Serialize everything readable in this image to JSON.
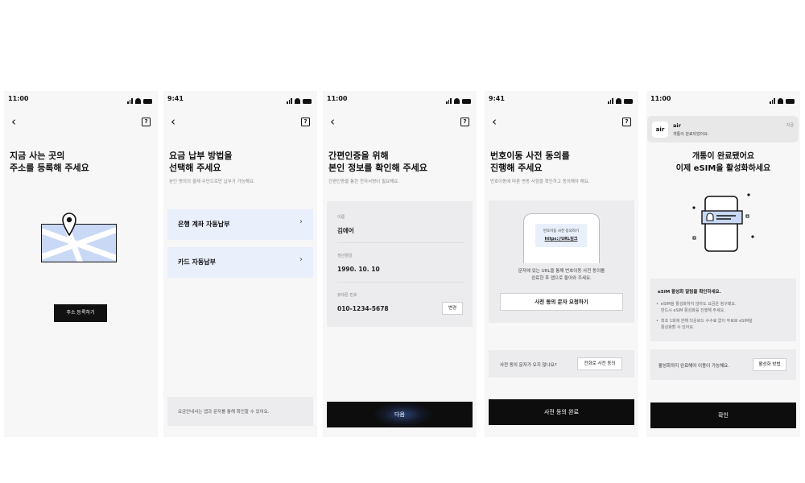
{
  "colors": {
    "accent_card": "#e9f0fc",
    "map_fill": "#c9d8f5",
    "primary_button": "#0d0d0d",
    "background": "#f7f7f8"
  },
  "icons": {
    "back": "chevron-left-icon",
    "help": "help-question-icon"
  },
  "screens": [
    {
      "status_time": "11:00",
      "title": "지금 사는 곳의\n주소를 등록해 주세요",
      "register_button": "주소 등록하기"
    },
    {
      "status_time": "9:41",
      "title": "요금 납부 방법을\n선택해 주세요",
      "subtitle": "본인 명의의 결제 수단으로만 납부가 가능해요.",
      "options": [
        "은행 계좌 자동납부",
        "카드 자동납부"
      ],
      "notice": "요금안내서는 앱과 문자를 통해 확인할 수 있어요."
    },
    {
      "status_time": "11:00",
      "title": "간편인증을 위해\n본인 정보를 확인해 주세요",
      "subtitle": "간편인증을 통한 전자서명이 필요해요.",
      "fields": [
        {
          "label": "이름",
          "value": "김에어"
        },
        {
          "label": "생년월일",
          "value": "1990. 10. 10"
        },
        {
          "label": "휴대폰 번호",
          "value": "010-1234-5678"
        }
      ],
      "change_button": "변경",
      "next_button": "다음"
    },
    {
      "status_time": "9:41",
      "title": "번호이동 사전 동의를\n진행해 주세요",
      "subtitle": "번호이동에 따른 변동 사항을 확인하고 동의해야 해요.",
      "sms_preview_title": "번호이동 사전 동의하기",
      "sms_preview_link": "https://URL링크",
      "description": "문자에 있는 URL을 통해 번호이동 사전 동의를\n완료한 후 앱으로 돌아와 주세요.",
      "request_button": "사전 동의 문자 요청하기",
      "no_sms_question": "사전 동의 문자가 오지 않나요?",
      "phone_consent_button": "전화로 사전 동의",
      "complete_button": "사전 동의 완료"
    },
    {
      "status_time": "11:00",
      "notification": {
        "app_icon_text": "air",
        "title": "air",
        "body": "개통이 완료되었어요.",
        "time": "지금"
      },
      "title": "개통이 완료됐어요\n이제 eSIM을 활성화하세요",
      "info_heading": "eSIM 활성화 알림을 확인하세요.",
      "info_items": [
        "eSIM을 활성화하지 않아도 요금은 청구돼요.\n반드시 eSIM 활성화를 진행해 주세요.",
        "최초 1회에 한해 다운로드 수수료 없이 무료로 eSIM을\n활성화할 수 있어요."
      ],
      "activation_question": "활성화까지 완료해야 이용이 가능해요.",
      "activation_method_button": "활성화 방법",
      "confirm_button": "확인"
    }
  ]
}
